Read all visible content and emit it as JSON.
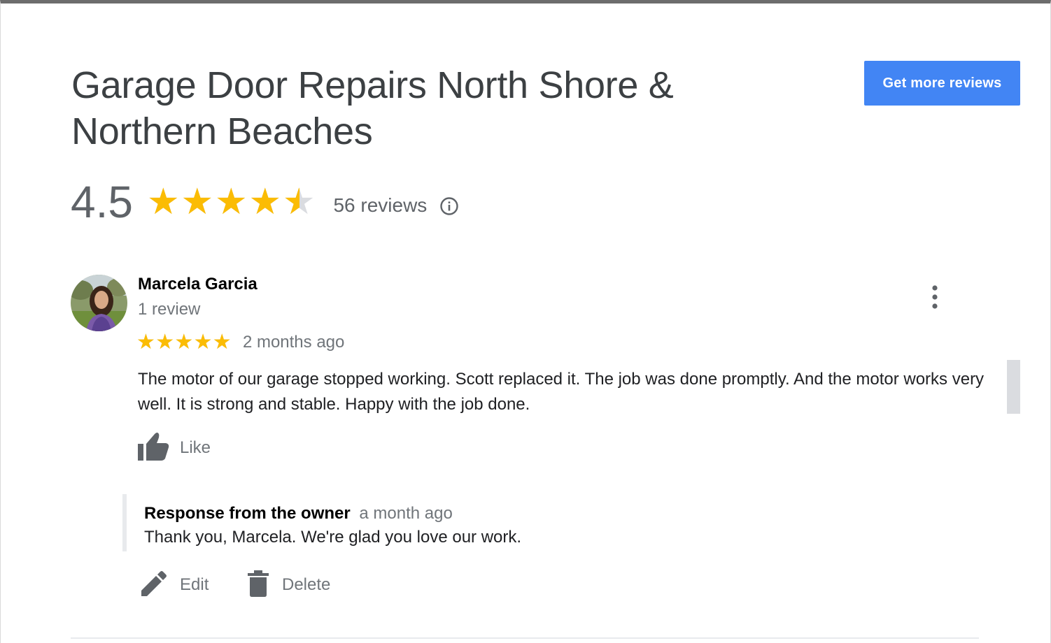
{
  "business": {
    "name": "Garage Door Repairs North Shore & Northern Beaches",
    "rating": "4.5",
    "rating_value": 4.5,
    "rating_max": 5,
    "review_count_label": "56 reviews"
  },
  "header": {
    "get_more_reviews_label": "Get more reviews"
  },
  "colors": {
    "accent_button": "#4285f4",
    "star_filled": "#fbbc04",
    "star_empty": "#dadce0",
    "secondary_text": "#70757a"
  },
  "icons": {
    "info": "info-circle-icon",
    "menu": "more-vert-icon",
    "like": "thumb-up-icon",
    "edit": "pencil-icon",
    "delete": "trash-icon"
  },
  "review": {
    "author": "Marcela Garcia",
    "author_reviews": "1 review",
    "stars": 5,
    "date": "2 months ago",
    "text": "The motor of our garage stopped working. Scott replaced it. The job was done promptly. And the motor works very well. It is strong and stable. Happy with the job done.",
    "like_label": "Like",
    "owner_response": {
      "label": "Response from the owner",
      "date": "a month ago",
      "text": "Thank you, Marcela. We're glad you love our work."
    },
    "actions": {
      "edit_label": "Edit",
      "delete_label": "Delete"
    }
  }
}
